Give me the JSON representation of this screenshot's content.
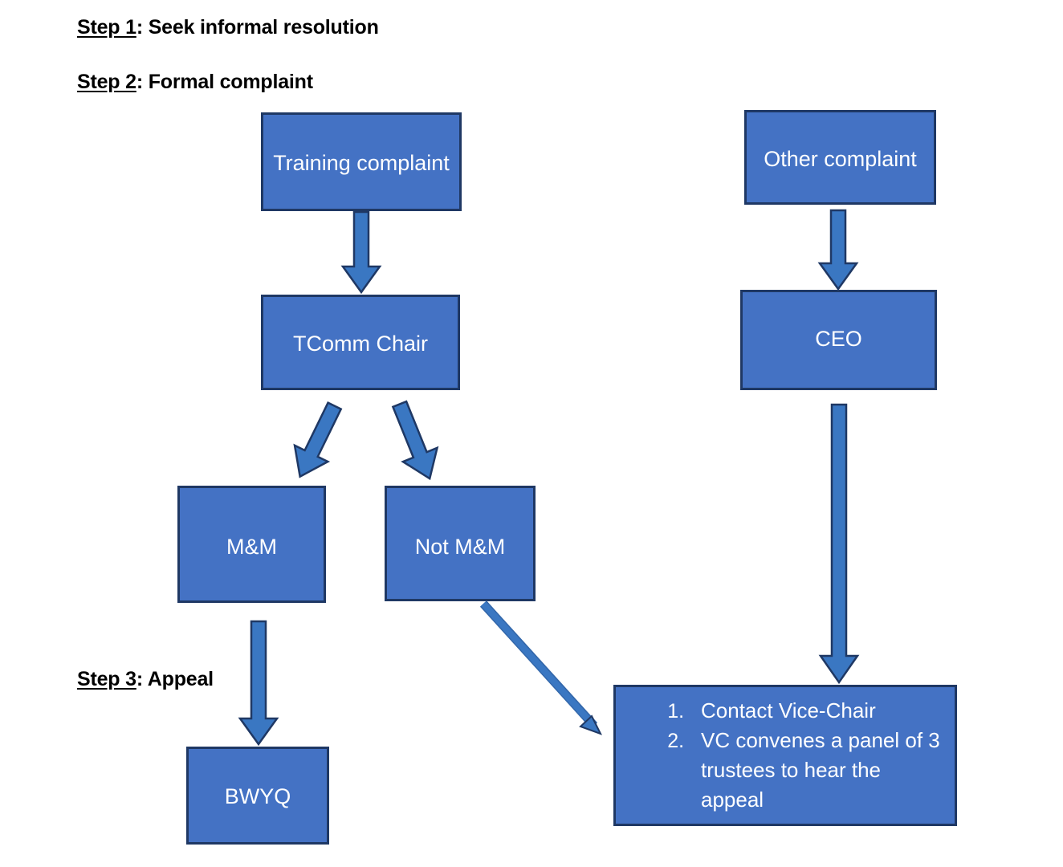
{
  "document": {
    "title": "Complaints procedure flowchart",
    "background_color": "#FFFFFF",
    "box_fill_color": "#4472C4",
    "box_border_color": "#1F3864",
    "box_text_color": "#FFFFFF",
    "arrow_fill_color": "#3A77C2",
    "arrow_border_color": "#1F3864",
    "heading_text_color": "#000000"
  },
  "headings": [
    {
      "label": "Step 1",
      "separator": ": ",
      "text": "Seek informal resolution"
    },
    {
      "label": "Step 2",
      "separator": ": ",
      "text": "Formal complaint"
    },
    {
      "label": "Step 3",
      "separator": ": ",
      "text": "Appeal"
    }
  ],
  "nodes": {
    "training_complaint": {
      "text": "Training  complaint"
    },
    "other_complaint": {
      "text": "Other complaint"
    },
    "tcomm_chair": {
      "text": "TComm Chair"
    },
    "ceo": {
      "text": "CEO"
    },
    "mm": {
      "text": "M&M"
    },
    "not_mm": {
      "text": "Not M&M"
    },
    "bwyq": {
      "text": "BWYQ"
    },
    "appeal": {
      "items": [
        "Contact Vice-Chair",
        "VC convenes a panel of 3 trustees to hear the appeal"
      ]
    }
  },
  "connectors": [
    {
      "name": "training-to-tcomm",
      "style": "block-arrow",
      "direction": "down"
    },
    {
      "name": "other-to-ceo",
      "style": "block-arrow",
      "direction": "down"
    },
    {
      "name": "tcomm-to-mm",
      "style": "block-arrow",
      "direction": "down-left"
    },
    {
      "name": "tcomm-to-not-mm",
      "style": "block-arrow",
      "direction": "down-right"
    },
    {
      "name": "mm-to-bwyq",
      "style": "block-arrow",
      "direction": "down"
    },
    {
      "name": "ceo-to-appeal",
      "style": "block-arrow",
      "direction": "down"
    },
    {
      "name": "not-mm-to-appeal",
      "style": "line-arrow",
      "direction": "down-right"
    }
  ]
}
